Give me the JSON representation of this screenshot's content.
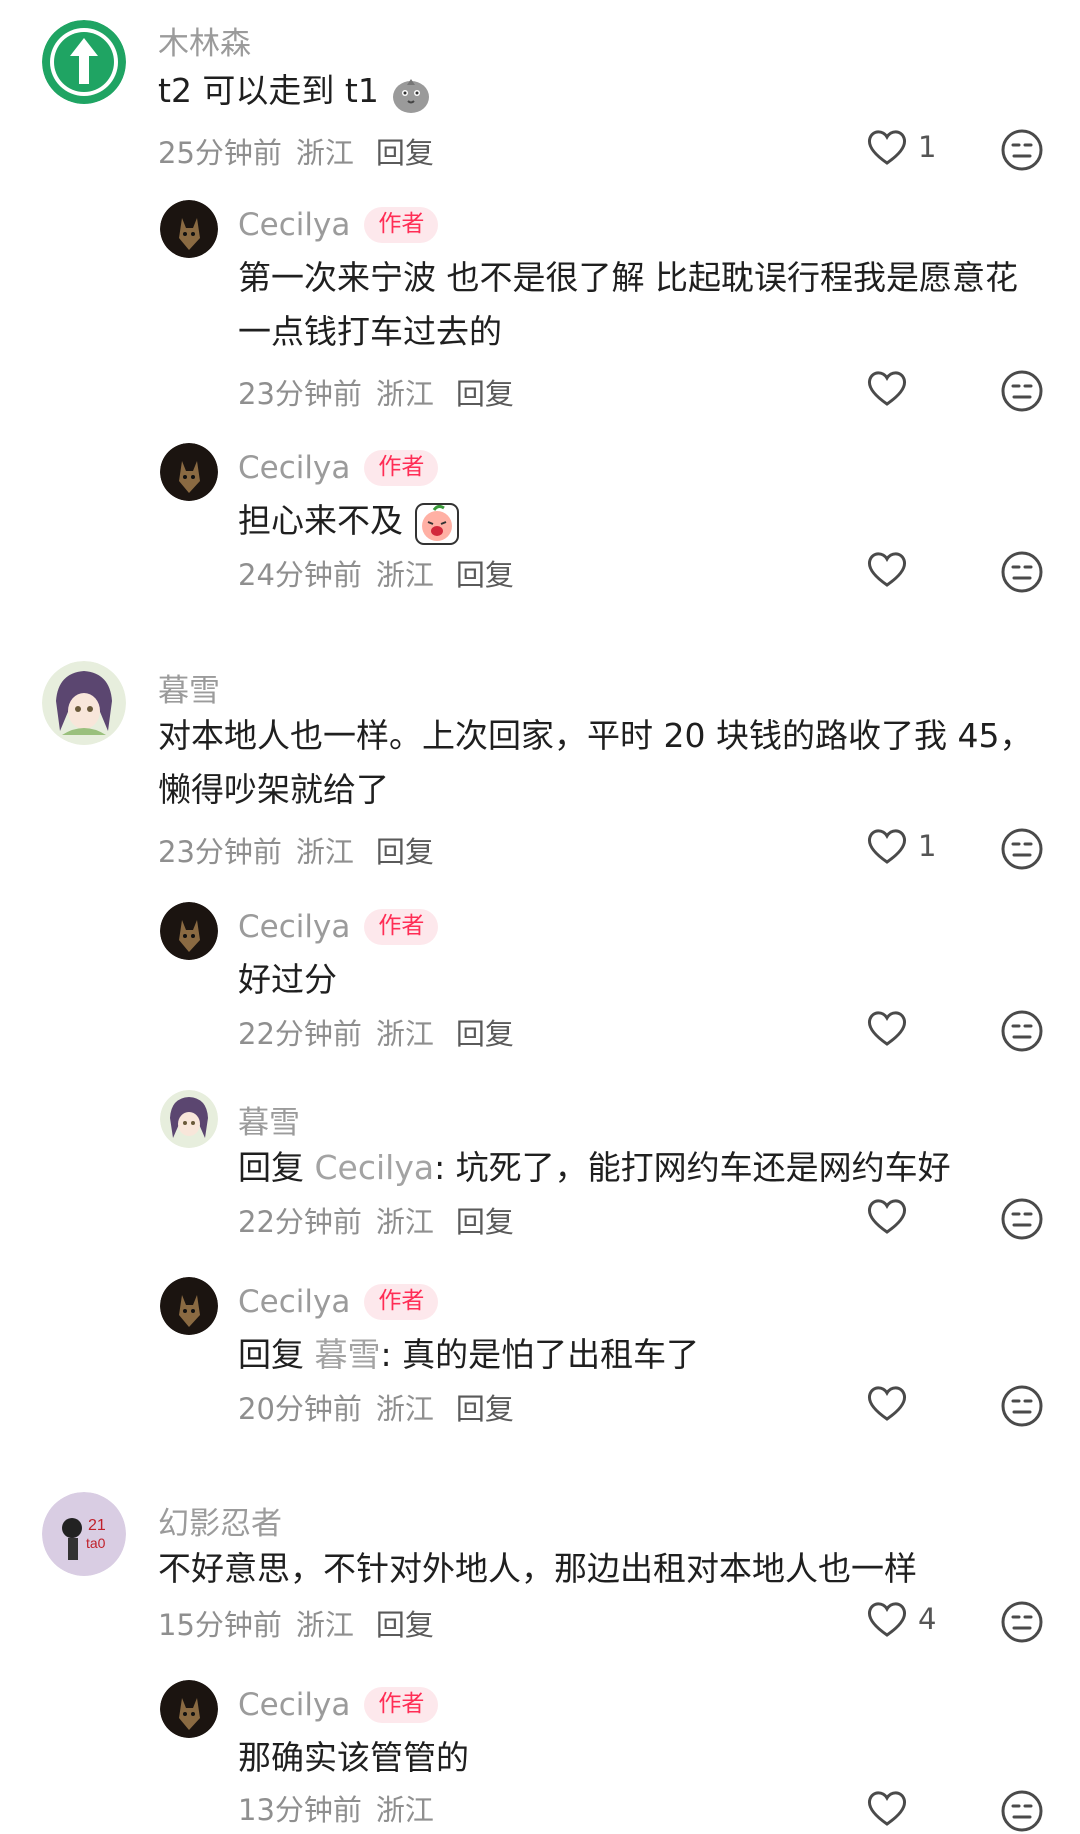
{
  "common": {
    "reply_label": "回复",
    "author_badge": "作者"
  },
  "comments": [
    {
      "user": "木林森",
      "text": "t2 可以走到 t1",
      "time": "25分钟前",
      "loc": "浙江",
      "likes": "1"
    },
    {
      "user": "Cecilya",
      "text_lines": [
        "第一次来宁波 也不是很了解 比起耽误行程我是愿意花",
        "一点钱打车过去的"
      ],
      "time": "23分钟前",
      "loc": "浙江",
      "likes": ""
    },
    {
      "user": "Cecilya",
      "text": "担心来不及",
      "time": "24分钟前",
      "loc": "浙江",
      "likes": ""
    },
    {
      "user": "暮雪",
      "text_lines": [
        "对本地人也一样。上次回家，平时 20 块钱的路收了我 45，",
        "懒得吵架就给了"
      ],
      "time": "23分钟前",
      "loc": "浙江",
      "likes": "1"
    },
    {
      "user": "Cecilya",
      "text": "好过分",
      "time": "22分钟前",
      "loc": "浙江",
      "likes": ""
    },
    {
      "user": "暮雪",
      "reply_to": "Cecilya",
      "text": ": 坑死了，能打网约车还是网约车好",
      "time": "22分钟前",
      "loc": "浙江",
      "likes": ""
    },
    {
      "user": "Cecilya",
      "reply_to": "暮雪",
      "text": ": 真的是怕了出租车了",
      "time": "20分钟前",
      "loc": "浙江",
      "likes": ""
    },
    {
      "user": "幻影忍者",
      "text": "不好意思，不针对外地人，那边出租对本地人也一样",
      "time": "15分钟前",
      "loc": "浙江",
      "likes": "4"
    },
    {
      "user": "Cecilya",
      "text": "那确实该管管的",
      "time": "13分钟前",
      "loc": "浙江",
      "likes": ""
    }
  ],
  "colors": {
    "accent_badge": "#ff2d55",
    "username": "#9b9b9b",
    "avatar_green": "#1fa463"
  },
  "icons": {
    "like": "heart-outline-icon",
    "dislike": "neutral-face-icon",
    "sticker_1": "gray-bird-sticker",
    "sticker_2": "crying-peach-sticker"
  }
}
